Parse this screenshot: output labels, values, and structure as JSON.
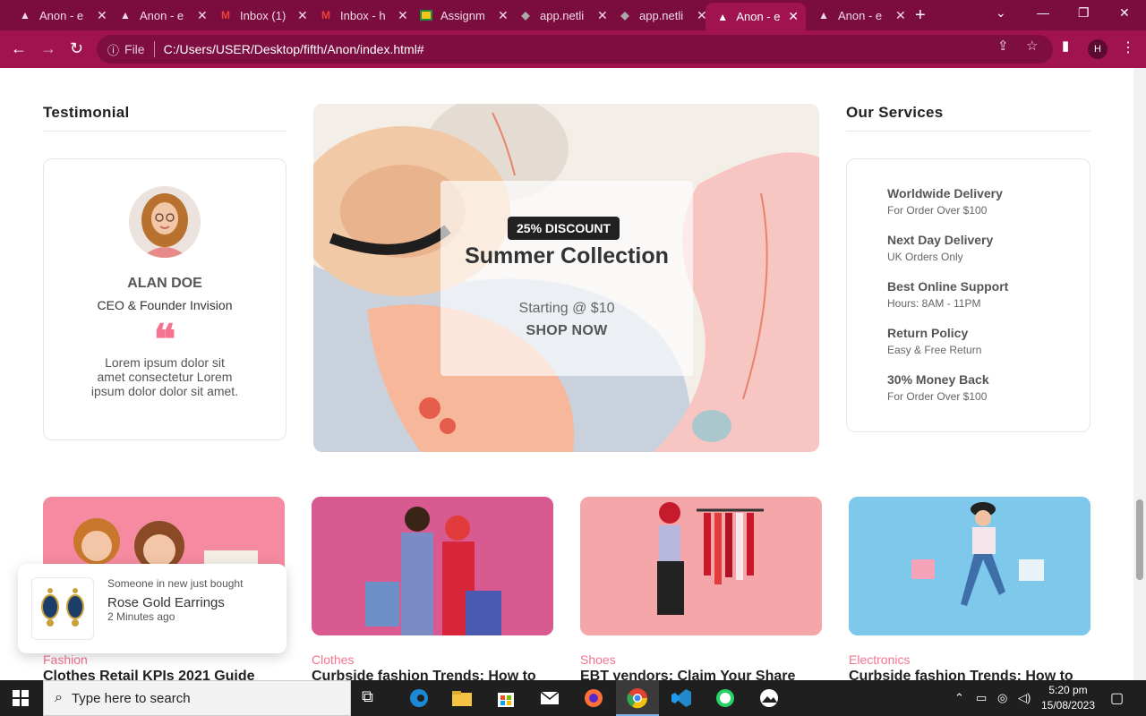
{
  "browser": {
    "tabs": [
      {
        "label": "Anon - e",
        "icon": "anon-logo-icon",
        "active": false
      },
      {
        "label": "Anon - e",
        "icon": "anon-logo-icon",
        "active": false
      },
      {
        "label": "Inbox (1)",
        "icon": "gmail-icon",
        "active": false
      },
      {
        "label": "Inbox - h",
        "icon": "gmail-icon",
        "active": false
      },
      {
        "label": "Assignm",
        "icon": "classroom-icon",
        "active": false
      },
      {
        "label": "app.netli",
        "icon": "netlify-icon",
        "active": false
      },
      {
        "label": "app.netli",
        "icon": "netlify-icon",
        "active": false
      },
      {
        "label": "Anon - e",
        "icon": "anon-logo-icon",
        "active": true
      },
      {
        "label": "Anon - e",
        "icon": "anon-logo-icon",
        "active": false
      }
    ],
    "address": {
      "scheme_label": "File",
      "url": "C:/Users/USER/Desktop/fifth/Anon/index.html#"
    },
    "profile_initial": "H",
    "colors": {
      "tabbar": "#7a0c3e",
      "toolbar": "#a0134f"
    }
  },
  "testimonial": {
    "section_title": "Testimonial",
    "name": "ALAN DOE",
    "role": "CEO & Founder Invision",
    "quote_mark": "❝",
    "text": "Lorem ipsum dolor sit amet consectetur Lorem ipsum dolor dolor sit amet."
  },
  "banner": {
    "badge": "25% DISCOUNT",
    "title": "Summer Collection",
    "subtitle": "Starting @ $10",
    "cta": "SHOP NOW"
  },
  "services": {
    "section_title": "Our Services",
    "items": [
      {
        "title": "Worldwide Delivery",
        "subtitle": "For Order Over $100"
      },
      {
        "title": "Next Day Delivery",
        "subtitle": "UK Orders Only"
      },
      {
        "title": "Best Online Support",
        "subtitle": "Hours: 8AM - 11PM"
      },
      {
        "title": "Return Policy",
        "subtitle": "Easy & Free Return"
      },
      {
        "title": "30% Money Back",
        "subtitle": "For Order Over $100"
      }
    ]
  },
  "blogs": [
    {
      "category": "Fashion",
      "title": "Clothes Retail KPIs 2021 Guide"
    },
    {
      "category": "Clothes",
      "title": "Curbside fashion Trends: How to"
    },
    {
      "category": "Shoes",
      "title": "EBT vendors: Claim Your Share"
    },
    {
      "category": "Electronics",
      "title": "Curbside fashion Trends: How to"
    }
  ],
  "notification": {
    "line1": "Someone in new just bought",
    "product": "Rose Gold Earrings",
    "time": "2 Minutes ago"
  },
  "taskbar": {
    "search_placeholder": "Type here to search",
    "time": "5:20 pm",
    "date": "15/08/2023"
  }
}
